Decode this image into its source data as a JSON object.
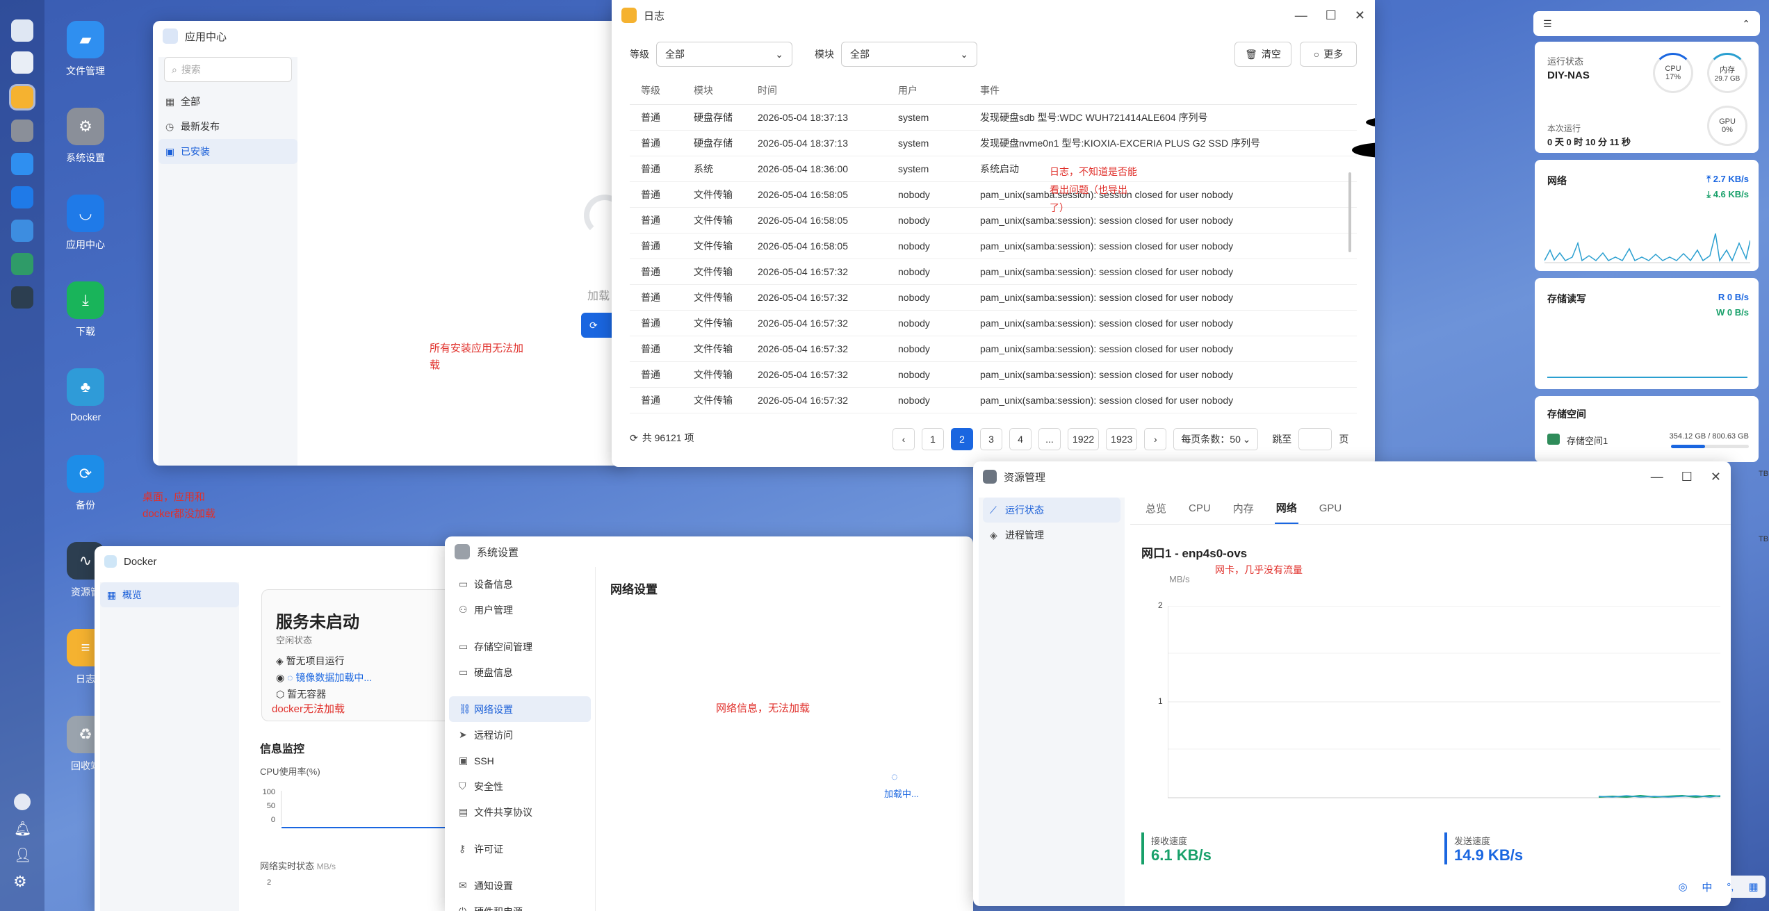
{
  "desktop": {
    "apps": [
      {
        "label": "文件管理",
        "icon": "folder-icon",
        "color": "#2f8ff0"
      },
      {
        "label": "系统设置",
        "icon": "gear-icon",
        "color": "#8a8f99"
      },
      {
        "label": "应用中心",
        "icon": "store-icon",
        "color": "#1f7ae8"
      },
      {
        "label": "下载",
        "icon": "download-icon",
        "color": "#19b45a"
      },
      {
        "label": "Docker",
        "icon": "docker-icon",
        "color": "#2f9bd8"
      },
      {
        "label": "备份",
        "icon": "backup-icon",
        "color": "#1d8de8"
      },
      {
        "label": "资源管",
        "icon": "monitor-icon",
        "color": "#2c3e50"
      },
      {
        "label": "日志",
        "icon": "log-icon",
        "color": "#f5b230"
      },
      {
        "label": "回收站",
        "icon": "recycle-icon",
        "color": "#9aa3ad"
      }
    ],
    "note_overlap": "桌面，应用和\ndocker都没加载"
  },
  "app_center": {
    "title": "应用中心",
    "search_placeholder": "搜索",
    "menu": [
      "全部",
      "最新发布",
      "已安装"
    ],
    "loading_text": "加载",
    "note": "所有安装应用无法加\n载"
  },
  "log_window": {
    "title": "日志",
    "level_label": "等级",
    "level_value": "全部",
    "module_label": "模块",
    "module_value": "全部",
    "clear_button": "清空",
    "more_button": "更多",
    "columns": [
      "等级",
      "模块",
      "时间",
      "用户",
      "事件"
    ],
    "rows": [
      [
        "普通",
        "硬盘存储",
        "2026-05-04 18:37:13",
        "system",
        "发现硬盘sdb 型号:WDC WUH721414ALE604 序列号"
      ],
      [
        "普通",
        "硬盘存储",
        "2026-05-04 18:37:13",
        "system",
        "发现硬盘nvme0n1 型号:KIOXIA-EXCERIA PLUS G2 SSD 序列号"
      ],
      [
        "普通",
        "系统",
        "2026-05-04 18:36:00",
        "system",
        "系统启动"
      ],
      [
        "普通",
        "文件传输",
        "2026-05-04 16:58:05",
        "nobody",
        "pam_unix(samba:session): session closed for user nobody"
      ],
      [
        "普通",
        "文件传输",
        "2026-05-04 16:58:05",
        "nobody",
        "pam_unix(samba:session): session closed for user nobody"
      ],
      [
        "普通",
        "文件传输",
        "2026-05-04 16:58:05",
        "nobody",
        "pam_unix(samba:session): session closed for user nobody"
      ],
      [
        "普通",
        "文件传输",
        "2026-05-04 16:57:32",
        "nobody",
        "pam_unix(samba:session): session closed for user nobody"
      ],
      [
        "普通",
        "文件传输",
        "2026-05-04 16:57:32",
        "nobody",
        "pam_unix(samba:session): session closed for user nobody"
      ],
      [
        "普通",
        "文件传输",
        "2026-05-04 16:57:32",
        "nobody",
        "pam_unix(samba:session): session closed for user nobody"
      ],
      [
        "普通",
        "文件传输",
        "2026-05-04 16:57:32",
        "nobody",
        "pam_unix(samba:session): session closed for user nobody"
      ],
      [
        "普通",
        "文件传输",
        "2026-05-04 16:57:32",
        "nobody",
        "pam_unix(samba:session): session closed for user nobody"
      ],
      [
        "普通",
        "文件传输",
        "2026-05-04 16:57:32",
        "nobody",
        "pam_unix(samba:session): session closed for user nobody"
      ]
    ],
    "note": "日志，不知道是否能\n看出问题（也导出\n了）",
    "total": "共 96121 项",
    "pages": [
      "1",
      "2",
      "3",
      "4",
      "...",
      "1922",
      "1923"
    ],
    "current_page": "2",
    "page_size": "每页条数：50",
    "jump_label": "跳至",
    "page_suffix": "页"
  },
  "widgets": {
    "status_title": "运行状态",
    "host": "DIY-NAS",
    "cpu_label": "CPU",
    "cpu_value": "17%",
    "cpu_fraction": 0.17,
    "mem_label": "内存",
    "mem_value": "29.7 GB",
    "gpu_label": "GPU",
    "gpu_value": "0%",
    "uptime_label": "本次运行",
    "uptime_value": "0 天 0 时 10 分 11 秒",
    "net_title": "网络",
    "net_up": "2.7 KB/s",
    "net_down": "4.6 KB/s",
    "io_title": "存储读写",
    "io_read": "R  0 B/s",
    "io_write": "W 0 B/s",
    "storage_title": "存储空间",
    "pool_name": "存储空间1",
    "pool_used": "354.12 GB",
    "pool_total": "800.63 GB",
    "pool_fraction": 0.44,
    "tb_suffix": "TB",
    "colors": {
      "net_line": "#2a9fd0",
      "up": "#1a66e0",
      "down": "#18a06a"
    }
  },
  "docker": {
    "title": "Docker",
    "nav": "概览",
    "status_title": "服务未启动",
    "status_sub": "空闲状态",
    "items": [
      "暂无项目运行",
      "镜像数据加载中...",
      "暂无容器"
    ],
    "note": "docker无法加载",
    "monitor_title": "信息监控",
    "cpu_chart_label": "CPU使用率(%)",
    "cpu_ticks": [
      "100",
      "50",
      "0"
    ],
    "net_chart_label": "网络实时状态",
    "net_unit": "MB/s",
    "net_tick": "2"
  },
  "settings": {
    "title": "系统设置",
    "menu": [
      "设备信息",
      "用户管理",
      "存储空间管理",
      "硬盘信息",
      "网络设置",
      "远程访问",
      "SSH",
      "安全性",
      "文件共享协议",
      "许可证",
      "通知设置",
      "硬件和电源"
    ],
    "active": "网络设置",
    "panel_title": "网络设置",
    "note": "网络信息，无法加载",
    "loading": "加载中..."
  },
  "resource": {
    "title": "资源管理",
    "menu": [
      "运行状态",
      "进程管理"
    ],
    "tabs": [
      "总览",
      "CPU",
      "内存",
      "网络",
      "GPU"
    ],
    "active_tab": "网络",
    "iface": "网口1 - enp4s0-ovs",
    "unit": "MB/s",
    "note": "网卡，几乎没有流量",
    "y_ticks": [
      "2",
      "1"
    ],
    "rx_label": "接收速度",
    "rx_value": "6.1 KB/s",
    "tx_label": "发送速度",
    "tx_value": "14.9 KB/s"
  },
  "tray": {
    "ime": "中"
  }
}
